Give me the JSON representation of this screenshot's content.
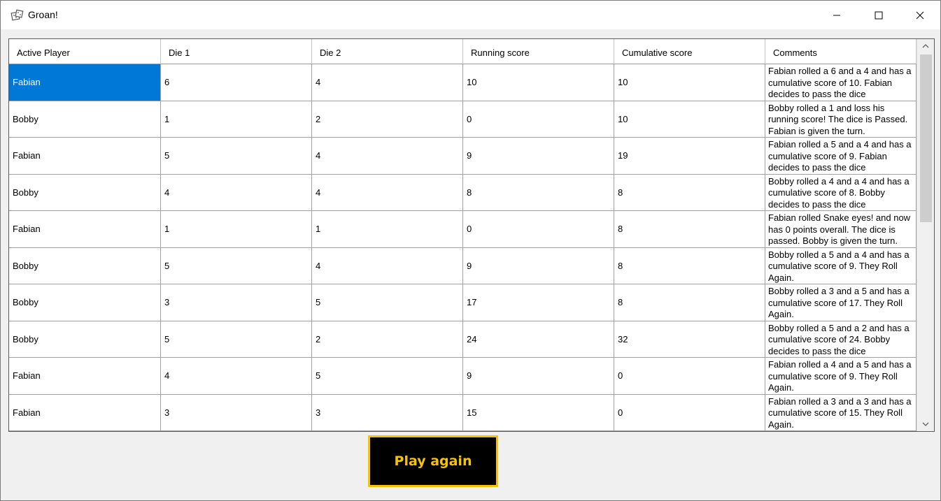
{
  "window": {
    "title": "Groan!",
    "icon": "dice-icon"
  },
  "grid": {
    "columns": [
      "Active Player",
      "Die 1",
      "Die 2",
      "Running score",
      "Cumulative score",
      "Comments"
    ],
    "rows": [
      {
        "player": "Fabian",
        "die1": "6",
        "die2": "4",
        "running": "10",
        "cumulative": "10",
        "comment": "Fabian rolled a 6 and a 4 and has a cumulative score of 10. Fabian decides to pass the dice"
      },
      {
        "player": "Bobby",
        "die1": "1",
        "die2": "2",
        "running": "0",
        "cumulative": "10",
        "comment": "Bobby rolled  a 1 and loss his running score! The dice is Passed. Fabian is given the turn."
      },
      {
        "player": "Fabian",
        "die1": "5",
        "die2": "4",
        "running": "9",
        "cumulative": "19",
        "comment": "Fabian rolled a 5 and a 4 and has a cumulative score of 9. Fabian decides to pass the dice"
      },
      {
        "player": "Bobby",
        "die1": "4",
        "die2": "4",
        "running": "8",
        "cumulative": "8",
        "comment": "Bobby rolled a 4 and a 4 and has a cumulative score of 8. Bobby decides to pass the dice"
      },
      {
        "player": "Fabian",
        "die1": "1",
        "die2": "1",
        "running": "0",
        "cumulative": "8",
        "comment": "Fabian rolled Snake eyes! and now has 0 points overall. The dice is passed. Bobby is given the turn."
      },
      {
        "player": "Bobby",
        "die1": "5",
        "die2": "4",
        "running": "9",
        "cumulative": "8",
        "comment": "Bobby rolled a 5 and a 4 and has a cumulative score of 9. They Roll Again."
      },
      {
        "player": "Bobby",
        "die1": "3",
        "die2": "5",
        "running": "17",
        "cumulative": "8",
        "comment": "Bobby rolled a 3 and a 5 and has a cumulative score of 17. They Roll Again."
      },
      {
        "player": "Bobby",
        "die1": "5",
        "die2": "2",
        "running": "24",
        "cumulative": "32",
        "comment": "Bobby rolled a 5 and a 2 and has a cumulative score of 24. Bobby decides to pass the dice"
      },
      {
        "player": "Fabian",
        "die1": "4",
        "die2": "5",
        "running": "9",
        "cumulative": "0",
        "comment": "Fabian rolled a 4 and a 5 and has a cumulative score of 9. They Roll Again."
      },
      {
        "player": "Fabian",
        "die1": "3",
        "die2": "3",
        "running": "15",
        "cumulative": "0",
        "comment": "Fabian rolled a 3 and a 3 and has a cumulative score of 15. They Roll Again."
      }
    ],
    "selected_row": 0,
    "selection_color": "#0078d7"
  },
  "actions": {
    "play_again_label": "Play again",
    "button_bg": "#000000",
    "button_accent": "#f5c400"
  }
}
